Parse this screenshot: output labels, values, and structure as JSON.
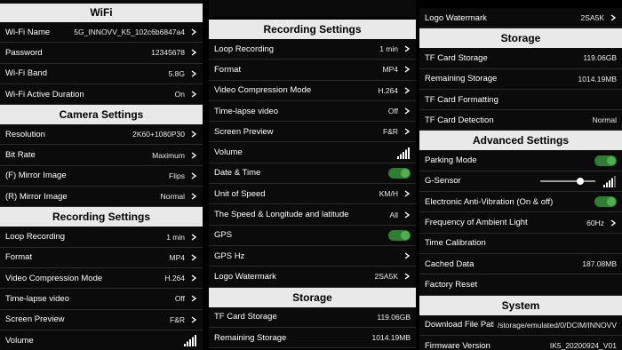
{
  "col1": {
    "wifi_header": "WiFi",
    "wifi": [
      {
        "label": "Wi-Fi Name",
        "value": "5G_INNOVV_K5_102c6b6847a4",
        "chevron": true
      },
      {
        "label": "Password",
        "value": "12345678",
        "chevron": true
      },
      {
        "label": "Wi-Fi Band",
        "value": "5.8G",
        "chevron": true
      },
      {
        "label": "Wi-Fi Active Duration",
        "value": "On",
        "chevron": true
      }
    ],
    "camera_header": "Camera Settings",
    "camera": [
      {
        "label": "Resolution",
        "value": "2K60+1080P30",
        "chevron": true
      },
      {
        "label": "Bit Rate",
        "value": "Maximum",
        "chevron": true
      },
      {
        "label": "(F) Mirror Image",
        "value": "Flips",
        "chevron": true
      },
      {
        "label": "(R) Mirror Image",
        "value": "Normal",
        "chevron": true
      }
    ],
    "recording_header": "Recording Settings",
    "recording": [
      {
        "label": "Loop Recording",
        "value": "1 min",
        "chevron": true
      },
      {
        "label": "Format",
        "value": "MP4",
        "chevron": true
      },
      {
        "label": "Video Compression Mode",
        "value": "H.264",
        "chevron": true
      },
      {
        "label": "Time-lapse video",
        "value": "Off",
        "chevron": true
      },
      {
        "label": "Screen Preview",
        "value": "F&R",
        "chevron": true
      },
      {
        "label": "Volume",
        "value": "",
        "chevron": false
      }
    ]
  },
  "col2": {
    "recording_header": "Recording Settings",
    "recording": [
      {
        "label": "Loop Recording",
        "value": "1 min",
        "chevron": true
      },
      {
        "label": "Format",
        "value": "MP4",
        "chevron": true
      },
      {
        "label": "Video Compression Mode",
        "value": "H.264",
        "chevron": true
      },
      {
        "label": "Time-lapse video",
        "value": "Off",
        "chevron": true
      },
      {
        "label": "Screen Preview",
        "value": "F&R",
        "chevron": true
      },
      {
        "label": "Volume",
        "value": "",
        "chevron": false
      },
      {
        "label": "Date & Time",
        "value": "",
        "chevron": false
      },
      {
        "label": "Unit of Speed",
        "value": "KM/H",
        "chevron": true
      },
      {
        "label": "The Speed & Longitude and latitude",
        "value": "All",
        "chevron": true
      },
      {
        "label": "GPS",
        "value": "",
        "chevron": false
      },
      {
        "label": "GPS Hz",
        "value": "",
        "chevron": true
      },
      {
        "label": "Logo Watermark",
        "value": "2SA5K",
        "chevron": true
      }
    ],
    "storage_header": "Storage",
    "storage": [
      {
        "label": "TF Card Storage",
        "value": "119.06GB",
        "chevron": false
      },
      {
        "label": "Remaining Storage",
        "value": "1014.19MB",
        "chevron": false
      }
    ]
  },
  "col3": {
    "top": [
      {
        "label": "Logo Watermark",
        "value": "2SA5K",
        "chevron": true
      }
    ],
    "storage_header": "Storage",
    "storage": [
      {
        "label": "TF Card Storage",
        "value": "119.06GB",
        "chevron": false
      },
      {
        "label": "Remaining Storage",
        "value": "1014.19MB",
        "chevron": false
      },
      {
        "label": "TF Card Formatting",
        "value": "",
        "chevron": false
      },
      {
        "label": "TF Card Detection",
        "value": "Normal",
        "chevron": false
      }
    ],
    "advanced_header": "Advanced Settings",
    "advanced": [
      {
        "label": "Parking Mode",
        "value": "",
        "chevron": false
      },
      {
        "label": "G-Sensor",
        "value": "",
        "chevron": false
      },
      {
        "label": "Electronic Anti-Vibration (On & off)",
        "value": "",
        "chevron": false
      },
      {
        "label": "Frequency of Ambient Light",
        "value": "60Hz",
        "chevron": true
      },
      {
        "label": "Time Calibration",
        "value": "",
        "chevron": false
      },
      {
        "label": "Cached Data",
        "value": "187.08MB",
        "chevron": false
      },
      {
        "label": "Factory Reset",
        "value": "",
        "chevron": false
      }
    ],
    "system_header": "System",
    "system": [
      {
        "label": "Download File Path",
        "value": "/storage/emulated/0/DCIM/INNOVV",
        "chevron": false
      },
      {
        "label": "Firmware Version",
        "value": "IK5_20200924_V01",
        "chevron": false
      }
    ]
  },
  "controls": {
    "date_time_toggle": "on",
    "gps_toggle": "on",
    "parking_mode_toggle": "on",
    "anti_vibration_toggle": "on",
    "g_sensor_level": 0.75,
    "volume_level_bars": 5,
    "accent_color": "#4caf50"
  },
  "icons": {
    "chevron": "chevron-right-icon",
    "volume": "volume-level-icon",
    "toggle": "toggle-switch"
  }
}
